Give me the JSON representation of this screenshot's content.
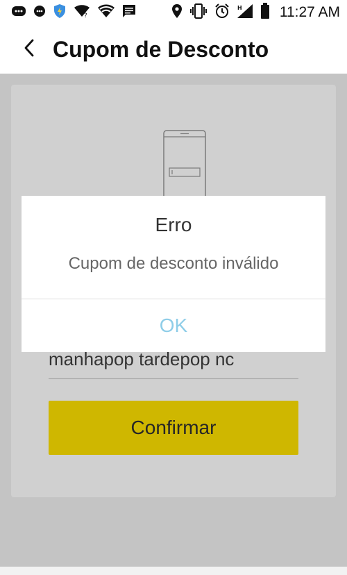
{
  "status_bar": {
    "time": "11:27 AM",
    "left_icons": [
      "messenger-icon",
      "chat-icon",
      "shield-icon",
      "wifi-question-icon",
      "wifi-icon",
      "message-icon"
    ],
    "right_icons": [
      "location-icon",
      "vibrate-icon",
      "alarm-icon",
      "signal-icon",
      "battery-icon"
    ]
  },
  "app_bar": {
    "title": "Cupom de Desconto",
    "back_icon": "back-arrow-icon"
  },
  "form": {
    "code_value": "manhapop tardepop nc",
    "confirm_label": "Confirmar"
  },
  "dialog": {
    "title": "Erro",
    "message": "Cupom de desconto inválido",
    "ok_label": "OK"
  },
  "colors": {
    "overlay_bg": "#c4c4c4",
    "confirm_button": "#cfb700",
    "ok_text": "#8ecde8"
  }
}
